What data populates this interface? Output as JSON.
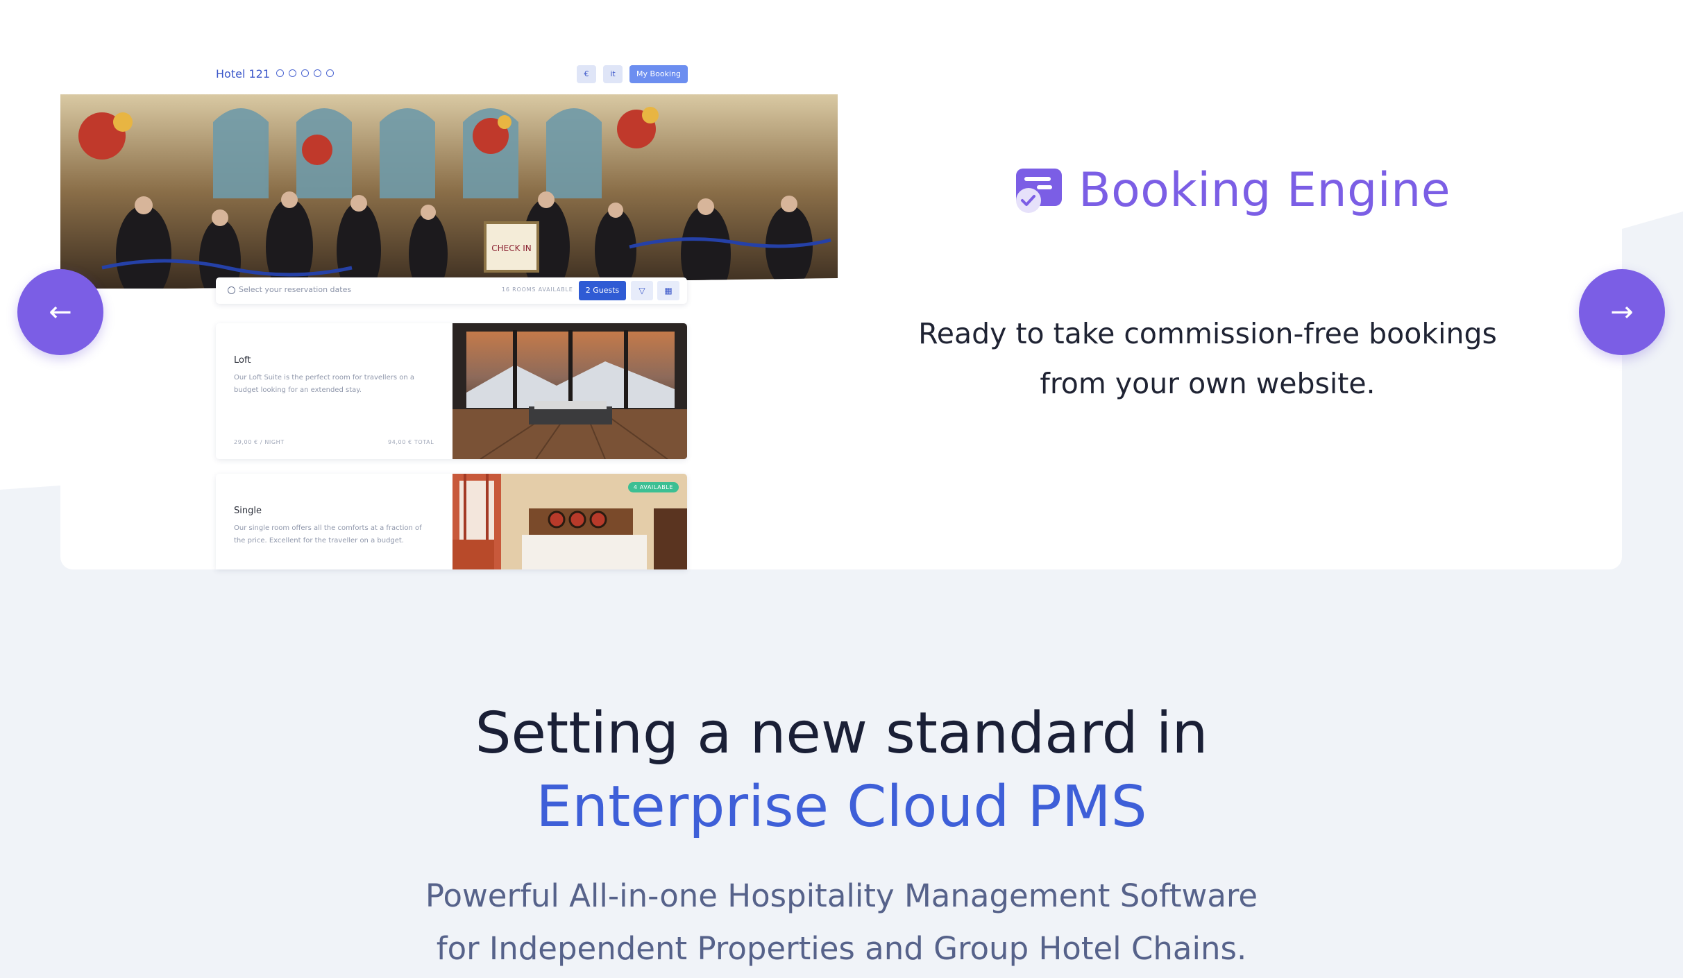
{
  "mockup": {
    "hotel_name": "Hotel 121",
    "currency_label": "€",
    "language_label": "it",
    "my_booking_label": "My Booking",
    "search_placeholder": "Select your reservation dates",
    "rooms_available": "16 ROOMS AVAILABLE",
    "guests_label": "2 Guests",
    "hero_sign_text": "CHECK IN",
    "rooms": [
      {
        "name": "Loft",
        "description": "Our Loft Suite is the perfect room for travellers on a budget looking for an extended stay.",
        "price_night": "29,00 € / NIGHT",
        "price_total": "94,00 € TOTAL"
      },
      {
        "name": "Single",
        "description": "Our single room offers all the comforts at a fraction of the price. Excellent for the traveller on a budget.",
        "badge": "4 AVAILABLE"
      }
    ]
  },
  "feature": {
    "title": "Booking Engine",
    "description": "Ready to take commission-free bookings from your own website.",
    "icon": "booking-engine-icon"
  },
  "carousel": {
    "prev_icon": "arrow-left-icon",
    "next_icon": "arrow-right-icon"
  },
  "hero_section": {
    "headline": "Setting a new standard in",
    "headline_accent": "Enterprise Cloud PMS",
    "subtitle": "Powerful All-in-one Hospitality Management Software for Independent Properties and Group Hotel Chains."
  },
  "colors": {
    "accent": "#7b5ee5",
    "brand_blue": "#3e5fd8",
    "background": "#f0f3f8"
  }
}
